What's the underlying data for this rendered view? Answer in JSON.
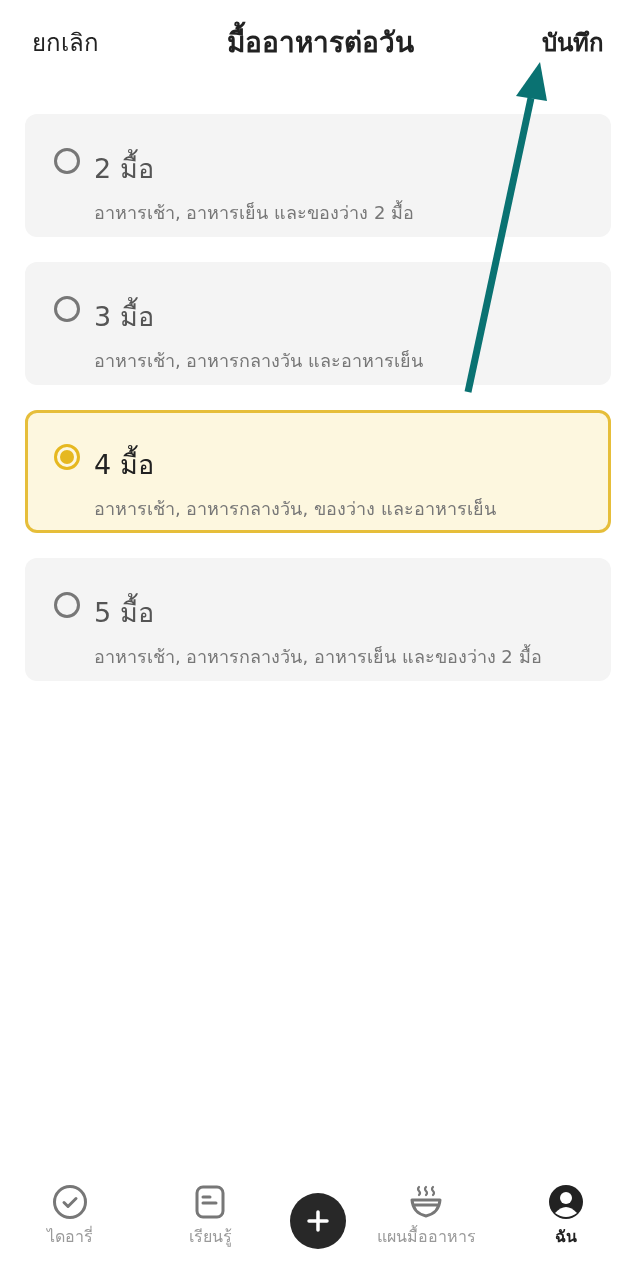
{
  "header": {
    "cancel": "ยกเลิก",
    "title": "มื้ออาหารต่อวัน",
    "save": "บันทึก"
  },
  "options": [
    {
      "label": "2 มื้อ",
      "description": "อาหารเช้า, อาหารเย็น และของว่าง 2 มื้อ",
      "selected": false
    },
    {
      "label": "3 มื้อ",
      "description": "อาหารเช้า, อาหารกลางวัน และอาหารเย็น",
      "selected": false
    },
    {
      "label": "4 มื้อ",
      "description": "อาหารเช้า, อาหารกลางวัน, ของว่าง และอาหารเย็น",
      "selected": true
    },
    {
      "label": "5 มื้อ",
      "description": "อาหารเช้า, อาหารกลางวัน, อาหารเย็น และของว่าง 2 มื้อ",
      "selected": false
    }
  ],
  "bottom_nav": [
    {
      "kind": "tab",
      "label": "ไดอารี่",
      "selected": false
    },
    {
      "kind": "tab",
      "label": "เรียนรู้",
      "selected": false
    },
    {
      "kind": "action"
    },
    {
      "kind": "tab",
      "label": "แผนมื้ออาหาร",
      "selected": false
    },
    {
      "kind": "tab",
      "label": "ฉัน",
      "selected": true
    }
  ]
}
